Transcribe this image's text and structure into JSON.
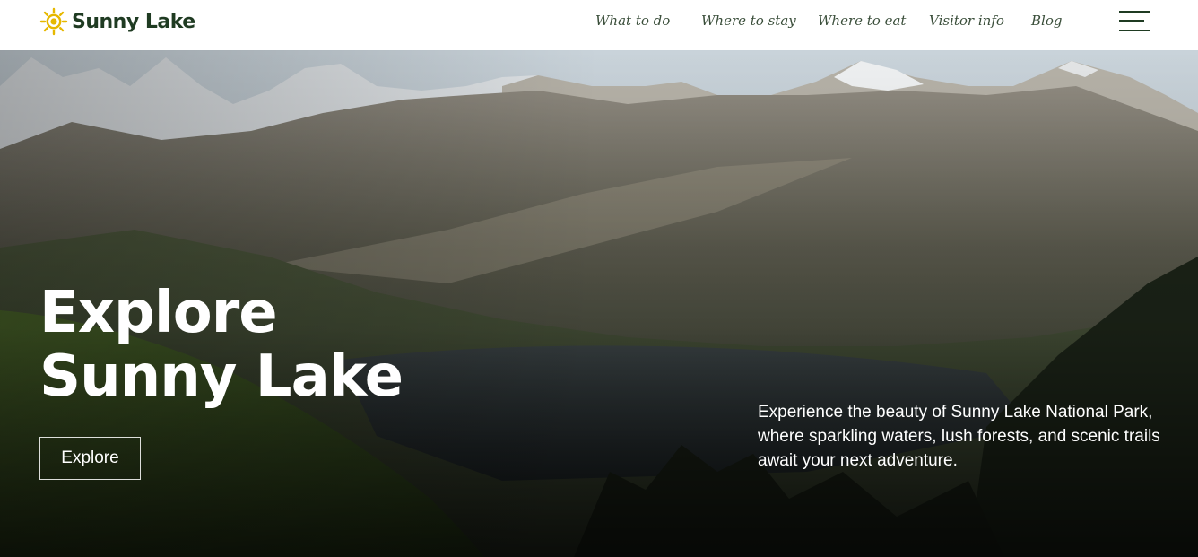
{
  "brand": {
    "name": "Sunny Lake",
    "icon": "sun-icon",
    "icon_color": "#e6b800"
  },
  "nav": {
    "items": [
      {
        "label": "What to do"
      },
      {
        "label": "Where to stay"
      },
      {
        "label": "Where to eat"
      },
      {
        "label": "Visitor info"
      },
      {
        "label": "Blog"
      }
    ],
    "menu_icon": "hamburger-menu-icon"
  },
  "hero": {
    "title_line1": "Explore",
    "title_line2": "Sunny Lake",
    "button_label": "Explore",
    "description": "Experience the beauty of Sunny Lake National Park, where sparkling waters, lush forests, and scenic trails await your next adventure."
  },
  "colors": {
    "brand_dark": "#1f3b22",
    "accent": "#e6b800"
  }
}
